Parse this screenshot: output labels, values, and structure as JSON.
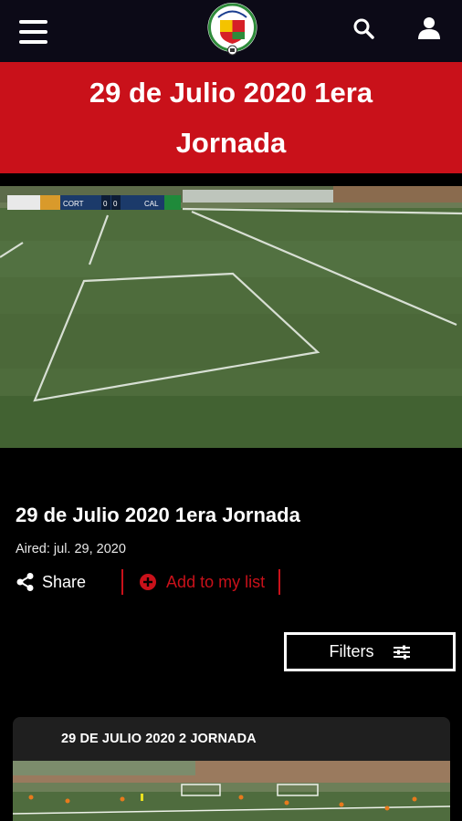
{
  "header": {
    "menu_icon": "hamburger-menu-icon",
    "logo_text": "CORTUVIDA",
    "search_icon": "search-icon",
    "user_icon": "user-account-icon",
    "background": "#0c0a17"
  },
  "banner": {
    "title": "29 de Julio 2020 1era Jornada",
    "background": "#c9111a"
  },
  "video": {
    "scoreboard": {
      "home": "CORT",
      "home_score": "0",
      "away_score": "0",
      "away": "CAL"
    }
  },
  "episode": {
    "title": "29 de Julio 2020 1era Jornada",
    "aired": "Aired: jul. 29, 2020",
    "share_label": "Share",
    "add_list_label": "Add to my list",
    "accent": "#c9111a"
  },
  "filters": {
    "label": "Filters",
    "icon": "sliders-icon"
  },
  "cards": [
    {
      "title": "29 DE JULIO 2020 2 JORNADA"
    }
  ]
}
